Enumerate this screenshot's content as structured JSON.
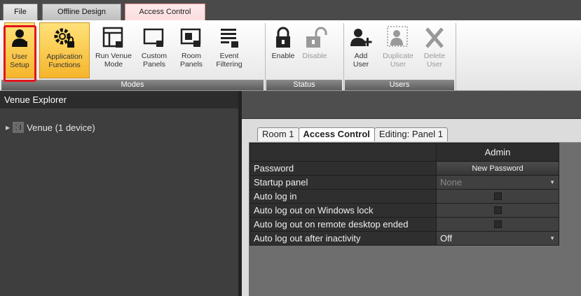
{
  "tabs": [
    {
      "label": "File"
    },
    {
      "label": "Offline Design"
    },
    {
      "label": "Access Control"
    }
  ],
  "ribbon": {
    "buttons": [
      {
        "line1": "User",
        "line2": "Setup",
        "icon": "user-icon"
      },
      {
        "line1": "Application",
        "line2": "Functions",
        "icon": "gear-lock-icon"
      },
      {
        "line1": "Run Venue",
        "line2": "Mode",
        "icon": "window-lock-icon"
      },
      {
        "line1": "Custom",
        "line2": "Panels",
        "icon": "panel-lock-icon"
      },
      {
        "line1": "Room",
        "line2": "Panels",
        "icon": "room-panel-lock-icon"
      },
      {
        "line1": "Event",
        "line2": "Filtering",
        "icon": "list-lock-icon"
      },
      {
        "line1": "Enable",
        "line2": "",
        "icon": "lock-closed-icon"
      },
      {
        "line1": "Disable",
        "line2": "",
        "icon": "lock-open-icon"
      },
      {
        "line1": "Add",
        "line2": "User",
        "icon": "add-user-icon"
      },
      {
        "line1": "Duplicate",
        "line2": "User",
        "icon": "duplicate-user-icon"
      },
      {
        "line1": "Delete",
        "line2": "User",
        "icon": "delete-x-icon"
      }
    ],
    "groups": [
      {
        "label": "Modes"
      },
      {
        "label": "Status"
      },
      {
        "label": "Users"
      }
    ]
  },
  "explorer": {
    "title": "Venue Explorer",
    "item": "Venue (1 device)"
  },
  "doc_tabs": [
    {
      "label": "Room 1"
    },
    {
      "label": "Access Control"
    },
    {
      "label": "Editing: Panel 1"
    }
  ],
  "grid": {
    "column_header": "Admin",
    "rows": [
      {
        "label": "Password",
        "value": "New Password"
      },
      {
        "label": "Startup panel",
        "value": "None"
      },
      {
        "label": "Auto log in",
        "value": ""
      },
      {
        "label": "Auto log out on Windows lock",
        "value": ""
      },
      {
        "label": "Auto log out on remote desktop ended",
        "value": ""
      },
      {
        "label": "Auto log out after inactivity",
        "value": "Off"
      }
    ]
  },
  "colors": {
    "active_tab": "#fbdede",
    "highlight": "#e3141b",
    "active_button": "#f6b52c"
  }
}
